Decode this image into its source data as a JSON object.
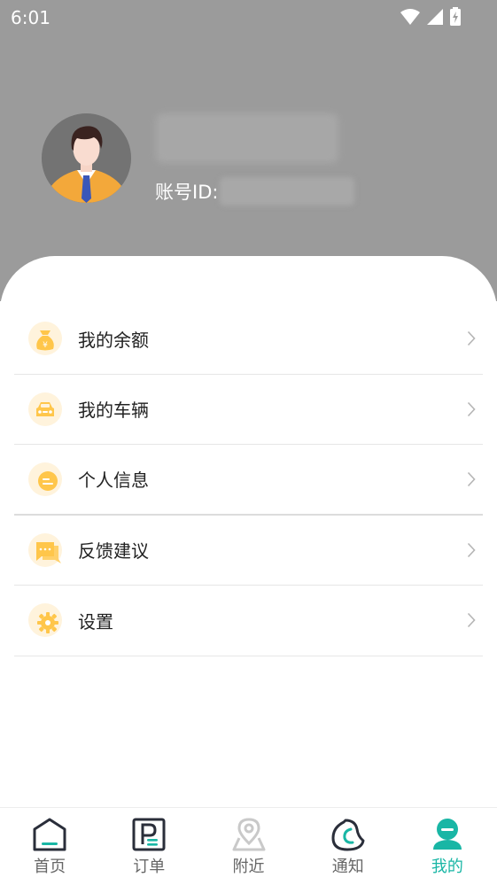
{
  "status_bar": {
    "time": "6:01"
  },
  "profile": {
    "account_label": "账号ID:"
  },
  "menu": {
    "items": [
      {
        "label": "我的余额",
        "icon": "money-bag-icon"
      },
      {
        "label": "我的车辆",
        "icon": "car-icon"
      },
      {
        "label": "个人信息",
        "icon": "profile-info-icon"
      },
      {
        "label": "反馈建议",
        "icon": "feedback-chat-icon"
      },
      {
        "label": "设置",
        "icon": "gear-icon"
      }
    ]
  },
  "bottom_nav": {
    "items": [
      {
        "label": "首页",
        "icon": "home-icon"
      },
      {
        "label": "订单",
        "icon": "parking-order-icon"
      },
      {
        "label": "附近",
        "icon": "location-pin-icon"
      },
      {
        "label": "通知",
        "icon": "notification-icon"
      },
      {
        "label": "我的",
        "icon": "user-icon",
        "active": true
      }
    ]
  },
  "colors": {
    "header_bg": "#9b9b9b",
    "accent": "#19b6a5",
    "icon_bg": "#fff3dc",
    "icon_fg": "#ffc64a"
  }
}
